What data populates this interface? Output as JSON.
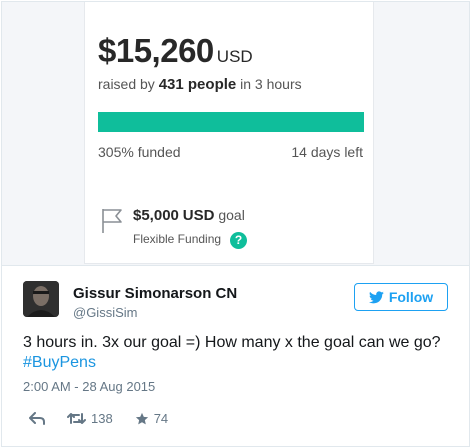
{
  "campaign": {
    "amount": "$15,260",
    "currency": "USD",
    "raised_prefix": "raised by",
    "people": "431 people",
    "raised_suffix": "in 3 hours",
    "progress_fraction": 1.0,
    "funded_text": "305% funded",
    "days_left_text": "14 days left",
    "goal_amount": "$5,000",
    "goal_currency": "USD",
    "goal_suffix": "goal",
    "flexible_text": "Flexible Funding",
    "help_glyph": "?",
    "accent_color": "#0fbe9b"
  },
  "tweet": {
    "name": "Gissur Simonarson CN",
    "handle": "@GissiSim",
    "follow_label": "Follow",
    "text": "3 hours in. 3x our goal =) How many x the goal can we go?",
    "hashtag": "#BuyPens",
    "timestamp": "2:00 AM - 28 Aug 2015",
    "retweets": "138",
    "likes": "74"
  },
  "icons": {
    "goal": "flag-icon",
    "help": "help-icon",
    "follow": "twitter-bird-icon",
    "reply": "reply-icon",
    "retweet": "retweet-icon",
    "like": "star-icon"
  }
}
